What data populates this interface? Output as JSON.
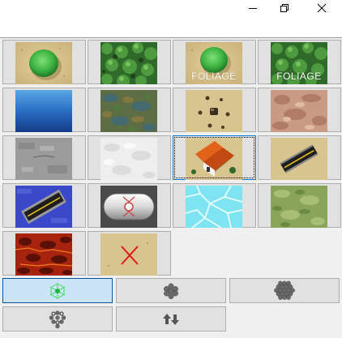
{
  "window": {
    "controls": [
      "minimize-icon",
      "restore-icon",
      "close-icon"
    ]
  },
  "tiles": [
    {
      "name": "grass-bush",
      "overlay": ""
    },
    {
      "name": "foliage-canopy",
      "overlay": ""
    },
    {
      "name": "grass-bush-foliage",
      "overlay": "FOLIAGE"
    },
    {
      "name": "foliage-canopy-foliage",
      "overlay": "FOLIAGE"
    },
    {
      "name": "deep-water",
      "overlay": ""
    },
    {
      "name": "swamp",
      "overlay": ""
    },
    {
      "name": "rocky-sand",
      "overlay": ""
    },
    {
      "name": "red-clay",
      "overlay": ""
    },
    {
      "name": "gray-concrete",
      "overlay": ""
    },
    {
      "name": "snow",
      "overlay": ""
    },
    {
      "name": "house",
      "overlay": "",
      "selected": true
    },
    {
      "name": "road-sand",
      "overlay": ""
    },
    {
      "name": "road-water",
      "overlay": ""
    },
    {
      "name": "fuel-tank",
      "overlay": ""
    },
    {
      "name": "ice",
      "overlay": ""
    },
    {
      "name": "grassland",
      "overlay": ""
    },
    {
      "name": "lava",
      "overlay": ""
    },
    {
      "name": "erase",
      "overlay": ""
    }
  ],
  "tools": [
    {
      "name": "single-cell-brush",
      "icon": "hex-single-icon",
      "active": true
    },
    {
      "name": "small-cluster-brush",
      "icon": "hex-cluster-small-icon",
      "active": false
    },
    {
      "name": "large-cluster-brush",
      "icon": "hex-cluster-large-icon",
      "active": false
    },
    {
      "name": "scatter-brush",
      "icon": "hex-scatter-icon",
      "active": false
    },
    {
      "name": "raise-lower",
      "icon": "up-down-arrows-icon",
      "active": false
    }
  ],
  "colors": {
    "accent": "#0078d7",
    "active_tool_bg": "#cce4f7",
    "button_bg": "#e1e1e1",
    "panel_bg": "#f0f0f0"
  }
}
